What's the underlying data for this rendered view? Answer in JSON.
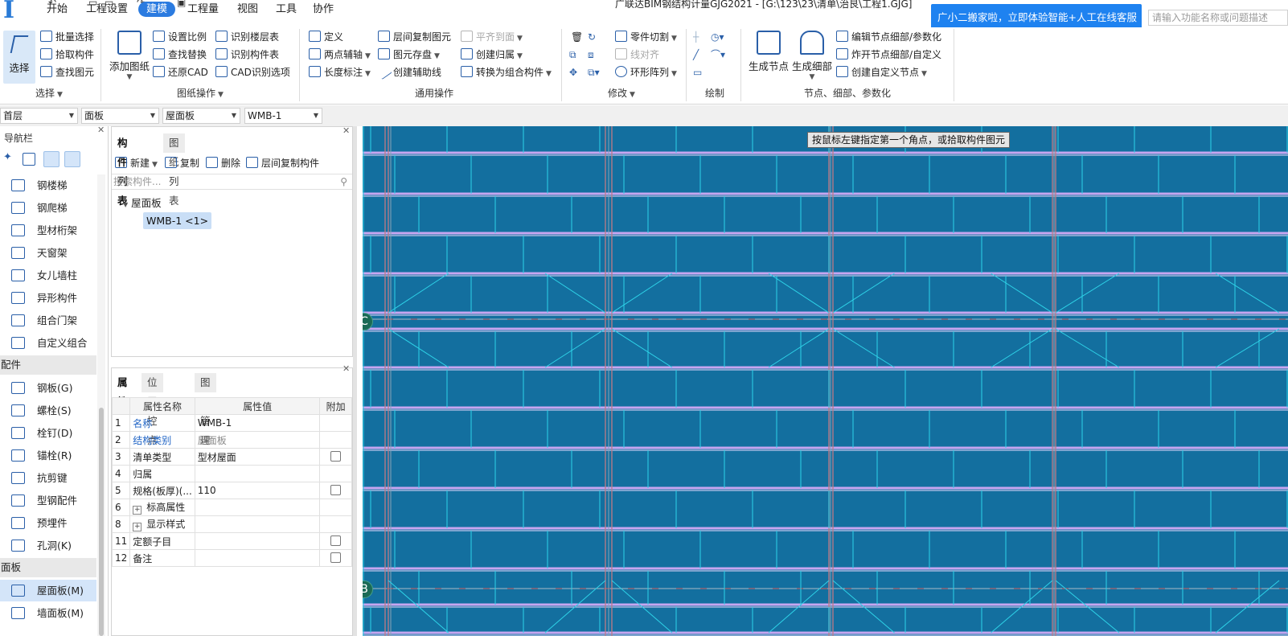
{
  "window": {
    "title": "广联达BIM钢结构计量GJG2021 - [G:\\123\\23\\清单\\治艮\\工程1.GJG]"
  },
  "menu": [
    "开始",
    "工程设置",
    "建模",
    "工程量",
    "视图",
    "工具",
    "协作"
  ],
  "active_menu": "建模",
  "promo": "广小二搬家啦，立即体验智能+人工在线客服",
  "search_placeholder": "请输入功能名称或问题描述",
  "ribbon": {
    "select": {
      "big": "选择",
      "items": [
        "批量选择",
        "拾取构件",
        "查找图元"
      ],
      "label": "选择"
    },
    "drawing": {
      "big": "添加图纸",
      "items": [
        "设置比例",
        "查找替换",
        "还原CAD",
        "识别楼层表",
        "识别构件表",
        "CAD识别选项"
      ],
      "label": "图纸操作"
    },
    "general": {
      "items": [
        "定义",
        "两点辅轴",
        "长度标注",
        "层间复制图元",
        "图元存盘",
        "创建辅助线",
        "平齐到面",
        "创建归属",
        "转换为组合构件"
      ],
      "label": "通用操作"
    },
    "modify": {
      "items": [
        "零件切割",
        "线对齐",
        "环形阵列"
      ],
      "label": "修改"
    },
    "draw": {
      "label": "绘制"
    },
    "node": {
      "big1": "生成节点",
      "big2": "生成细部",
      "items": [
        "编辑节点细部/参数化",
        "炸开节点细部/自定义",
        "创建自定义节点"
      ],
      "label": "节点、细部、参数化"
    }
  },
  "combos": [
    "首层",
    "面板",
    "屋面板",
    "WMB-1"
  ],
  "nav": {
    "title": "导航栏",
    "items_top": [
      "钢楼梯",
      "钢爬梯",
      "型材桁架",
      "天窗架",
      "女儿墙柱",
      "异形构件",
      "组合门架",
      "自定义组合"
    ],
    "cat1": "配件",
    "items_mid": [
      "钢板(G)",
      "螺栓(S)",
      "栓钉(D)",
      "锚栓(R)",
      "抗剪键",
      "型钢配件",
      "预埋件",
      "孔洞(K)"
    ],
    "cat2": "面板",
    "items_bot": [
      "屋面板(M)",
      "墙面板(M)"
    ]
  },
  "complist": {
    "tabs": [
      "构件列表",
      "图纸列表"
    ],
    "tools": [
      "新建",
      "复制",
      "删除",
      "层间复制构件"
    ],
    "search": "搜索构件...",
    "parent": "屋面板",
    "child": "WMB-1 <1>"
  },
  "props": {
    "tabs": [
      "属性",
      "位置控点",
      "图层管理"
    ],
    "headers": [
      "属性名称",
      "属性值",
      "附加"
    ],
    "rows": [
      {
        "n": "1",
        "name": "名称",
        "value": "WMB-1",
        "cb": false
      },
      {
        "n": "2",
        "name": "结构类别",
        "value": "屋面板",
        "cb": false
      },
      {
        "n": "3",
        "name": "清单类型",
        "value": "型材屋面",
        "cb": true
      },
      {
        "n": "4",
        "name": "归属",
        "value": "",
        "cb": false
      },
      {
        "n": "5",
        "name": "规格(板厚)(...",
        "value": "110",
        "cb": true
      },
      {
        "n": "6",
        "name": "标高属性",
        "value": "",
        "cb": false
      },
      {
        "n": "8",
        "name": "显示样式",
        "value": "",
        "cb": false
      },
      {
        "n": "11",
        "name": "定额子目",
        "value": "",
        "cb": true
      },
      {
        "n": "12",
        "name": "备注",
        "value": "",
        "cb": true
      }
    ]
  },
  "canvas": {
    "hint": "按鼠标左键指定第一个角点，或拾取构件图元",
    "axis_c": "C",
    "axis_b": "B"
  }
}
